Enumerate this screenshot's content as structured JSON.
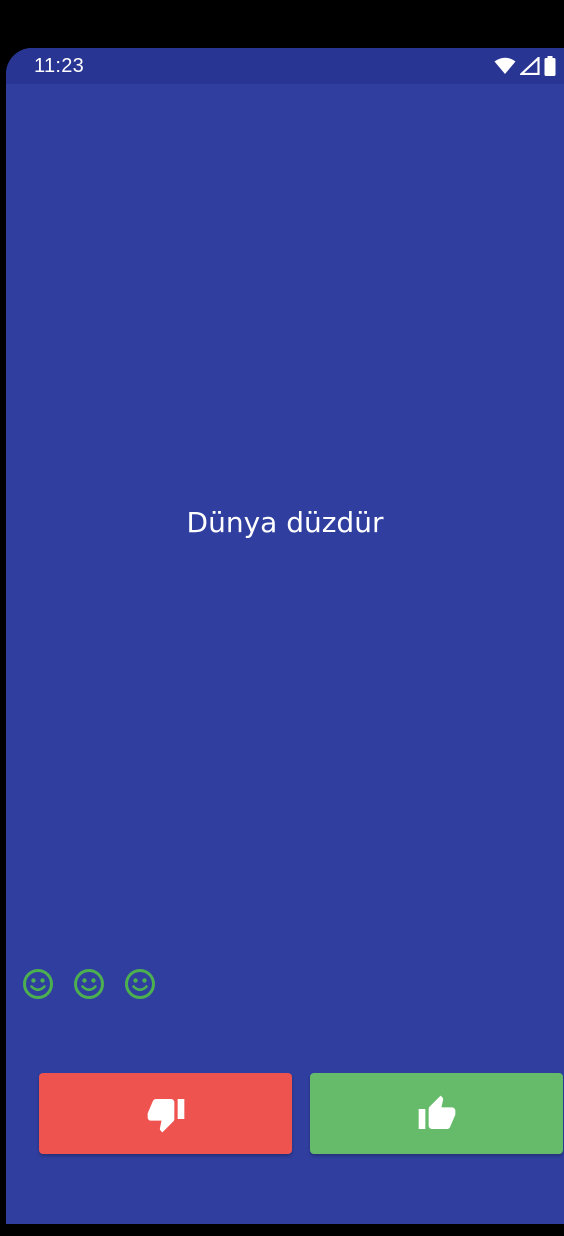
{
  "status_bar": {
    "time": "11:23",
    "icons": [
      "wifi-icon",
      "signal-icon",
      "battery-icon"
    ]
  },
  "question": {
    "text": "Dünya düzdür"
  },
  "lives": {
    "icons": [
      "smiley-icon",
      "smiley-icon",
      "smiley-icon"
    ],
    "color": "#4caf50"
  },
  "buttons": {
    "false_button": {
      "icon": "thumbs-down-icon",
      "color": "#ef5350"
    },
    "true_button": {
      "icon": "thumbs-up-icon",
      "color": "#66bb6a"
    }
  },
  "colors": {
    "background": "#303f9f",
    "status_bar": "#283593"
  }
}
